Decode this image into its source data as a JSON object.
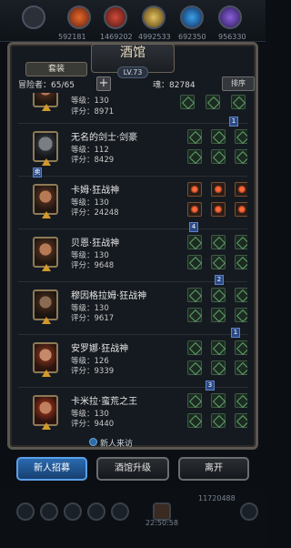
{
  "top_bar": {
    "resources": [
      "592181",
      "1469202",
      "4992533",
      "692350",
      "956330"
    ]
  },
  "panel": {
    "title": "酒馆",
    "level_badge": "LV.73",
    "tab_label": "套装",
    "adventurer_label": "冒险者：65/65",
    "plus_label": "+",
    "soul_label": "魂：82784",
    "sort_label": "排序"
  },
  "heroes": [
    {
      "name": "",
      "level": "等级：130",
      "score": "评分：8971",
      "badge": ""
    },
    {
      "name": "无名的剑士·剑豪",
      "level": "等级：112",
      "score": "评分：8429",
      "badge": "1"
    },
    {
      "name": "卡姆·狂战神",
      "level": "等级：130",
      "score": "评分：24248",
      "badge": ""
    },
    {
      "name": "贝恩·狂战神",
      "level": "等级：130",
      "score": "评分：9648",
      "badge": "4"
    },
    {
      "name": "穆因格拉姆·狂战神",
      "level": "等级：130",
      "score": "评分：9617",
      "badge": "2"
    },
    {
      "name": "安罗娜·狂战神",
      "level": "等级：126",
      "score": "评分：9339",
      "badge": "1"
    },
    {
      "name": "卡米拉·蛮荒之王",
      "level": "等级：130",
      "score": "评分：9440",
      "badge": "3"
    }
  ],
  "newcomer_label": "新人来访",
  "buttons": {
    "recruit": "新人招募",
    "upgrade": "酒馆升级",
    "leave": "离开"
  },
  "footer": {
    "gold": "11720488",
    "time": "22:50:58"
  },
  "colors": {
    "accent_blue": "#2a6ab0",
    "frame": "#5a5650"
  }
}
